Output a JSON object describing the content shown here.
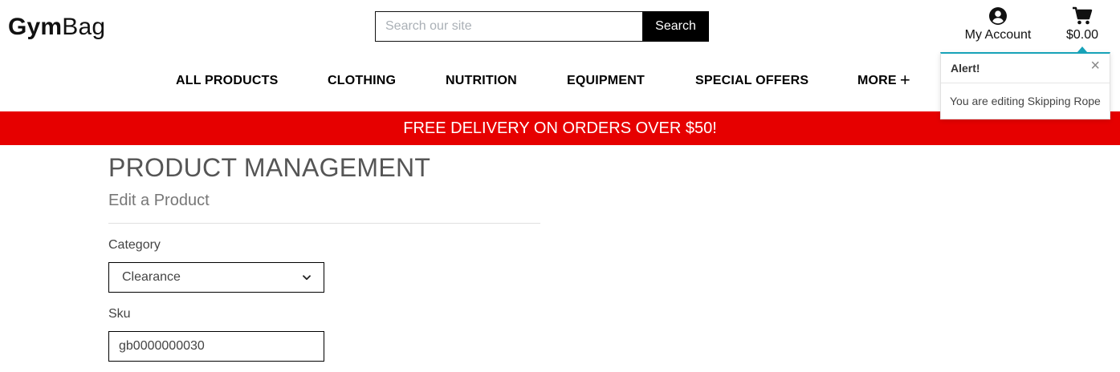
{
  "header": {
    "logo_bold": "Gym",
    "logo_regular": "Bag",
    "search": {
      "placeholder": "Search our site",
      "value": "",
      "button_label": "Search"
    },
    "account": {
      "icon": "user-circle-icon",
      "label": "My Account"
    },
    "bag": {
      "icon": "shopping-cart-icon",
      "total": "$0.00"
    }
  },
  "nav": {
    "items": [
      {
        "label": "ALL PRODUCTS"
      },
      {
        "label": "CLOTHING"
      },
      {
        "label": "NUTRITION"
      },
      {
        "label": "EQUIPMENT"
      },
      {
        "label": "SPECIAL OFFERS"
      },
      {
        "label": "MORE",
        "icon": "plus-icon"
      }
    ]
  },
  "banner": {
    "text": "FREE DELIVERY ON ORDERS OVER $50!",
    "color": "#e60000"
  },
  "toast": {
    "title": "Alert!",
    "message": "You are editing Skipping Rope",
    "accent_color": "#17a2b8"
  },
  "main": {
    "title": "PRODUCT MANAGEMENT",
    "subtitle": "Edit a Product",
    "form": {
      "category": {
        "label": "Category",
        "selected": "Clearance"
      },
      "sku": {
        "label": "Sku",
        "value": "gb0000000030"
      }
    }
  }
}
